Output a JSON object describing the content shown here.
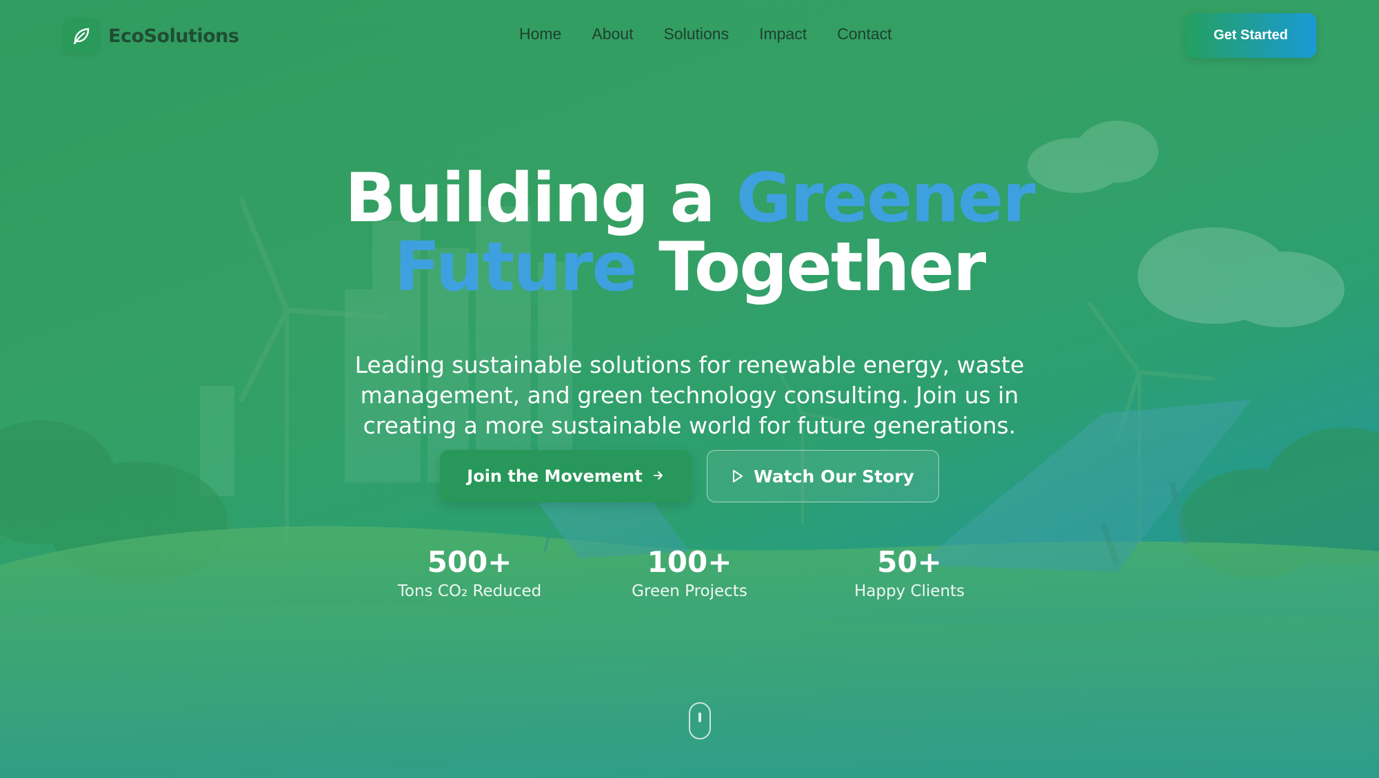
{
  "brand": {
    "name": "EcoSolutions",
    "icon": "leaf-icon",
    "colors": {
      "primary_green": "#27985a",
      "accent_blue": "#3fa0e0",
      "text_dark": "#1f3f2f"
    }
  },
  "nav": {
    "links": [
      "Home",
      "About",
      "Solutions",
      "Impact",
      "Contact"
    ],
    "cta": "Get Started"
  },
  "hero": {
    "headline_part1": "Building a ",
    "headline_accent1": "Greener",
    "headline_accent2": "Future",
    "headline_part2": " Together",
    "subtext": "Leading sustainable solutions for renewable energy, waste management, and green technology consulting. Join us in creating a more sustainable world for future generations.",
    "primary_button": "Join the Movement",
    "primary_button_icon": "arrow-right-icon",
    "secondary_button": "Watch Our Story",
    "secondary_button_icon": "play-icon"
  },
  "stats": [
    {
      "value": "500+",
      "label": "Tons CO₂ Reduced"
    },
    {
      "value": "100+",
      "label": "Green Projects"
    },
    {
      "value": "50+",
      "label": "Happy Clients"
    }
  ],
  "scroll_indicator": "mouse-scroll-icon"
}
